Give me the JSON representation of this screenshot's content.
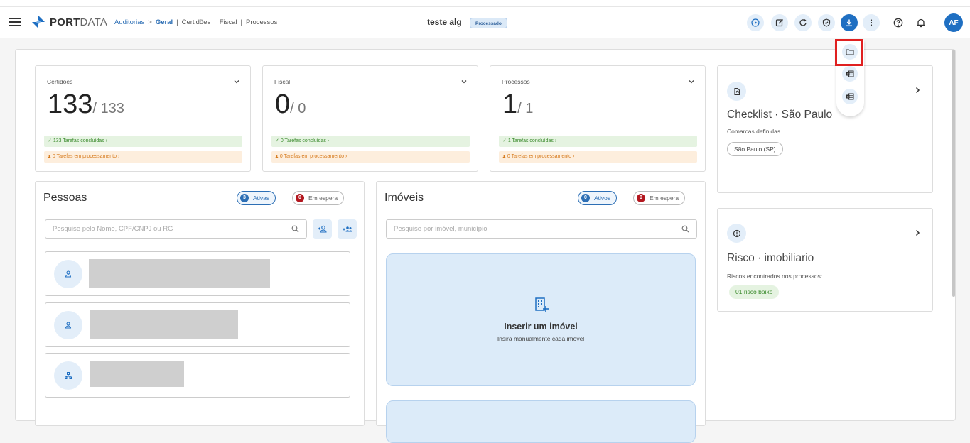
{
  "header": {
    "logo_bold": "PORT",
    "logo_light": "DATA",
    "breadcrumb": {
      "root": "Auditorias",
      "arrow": ">",
      "active": "Geral",
      "items": [
        "Certidões",
        "Fiscal",
        "Processos"
      ]
    },
    "doc_title": "teste alg",
    "status": "Processado",
    "avatar_initials": "AF"
  },
  "dropdown": {
    "items": [
      "folder-icon",
      "excel-icon",
      "excel-icon"
    ]
  },
  "stats": [
    {
      "label": "Certidões",
      "value": "133",
      "total": "/ 133",
      "done": "133 Tarefas concluídas",
      "processing": "0 Tarefas em processamento"
    },
    {
      "label": "Fiscal",
      "value": "0",
      "total": "/ 0",
      "done": "0 Tarefas concluídas",
      "processing": "0 Tarefas em processamento"
    },
    {
      "label": "Processos",
      "value": "1",
      "total": "/ 1",
      "done": "1 Tarefas concluídas",
      "processing": "0 Tarefas em processamento"
    }
  ],
  "checklist": {
    "title": "Checklist · São Paulo",
    "subtitle": "Comarcas definidas",
    "tag": "São Paulo (SP)"
  },
  "risco": {
    "title": "Risco · imobiliario",
    "subtitle": "Riscos encontrados nos processos:",
    "tag": "01 risco baixo"
  },
  "pessoas": {
    "title": "Pessoas",
    "active_count": "3",
    "active_label": "Ativas",
    "waiting_count": "0",
    "waiting_label": "Em espera",
    "search_placeholder": "Pesquise pelo Nome, CPF/CNPJ ou RG"
  },
  "imoveis": {
    "title": "Imóveis",
    "active_count": "0",
    "active_label": "Ativos",
    "waiting_count": "0",
    "waiting_label": "Em espera",
    "search_placeholder": "Pesquise por imóvel, município",
    "insert_title": "Inserir um imóvel",
    "insert_sub": "Insira manualmente cada imóvel"
  },
  "colors": {
    "accent": "#1f6fc2",
    "success_bg": "#e5f3e1",
    "warning_bg": "#fdeedd",
    "danger": "#b3171f",
    "highlight": "#e02020"
  }
}
